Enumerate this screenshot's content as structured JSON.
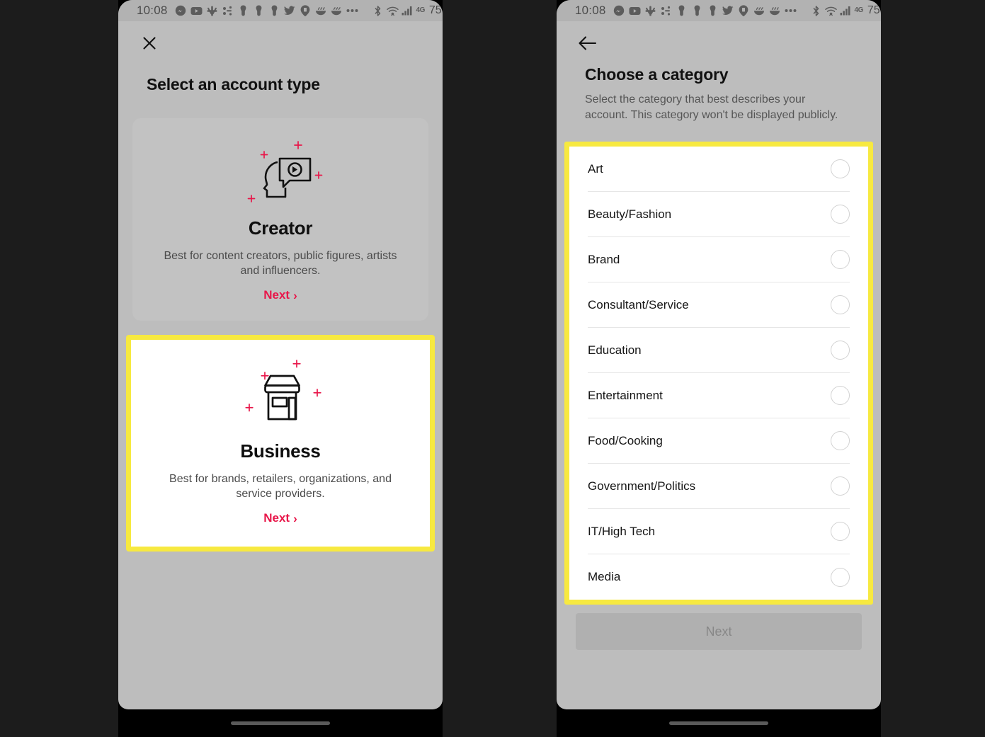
{
  "theme": {
    "screen_bg": "#bdbdbd",
    "statusbar_bg": "#b2b2b2",
    "card_bg": "#c2c2c2",
    "highlight_yellow": "#f7e940",
    "accent_red": "#e8174a",
    "frame_black": "#1c1c1c"
  },
  "status_bar": {
    "time": "10:08",
    "battery_percent": "75%",
    "network_label": "4G",
    "left_icons": [
      "messenger-icon",
      "youtube-icon",
      "slack-icon",
      "dots-connect-icon",
      "pin-hand-icon",
      "pin-hand-icon-2",
      "pin-hand-icon-3",
      "twitter-icon",
      "location-tag-icon",
      "food-bowl-icon",
      "food-bowl-icon-2",
      "more-dots-icon"
    ],
    "right_icons": [
      "bluetooth-icon",
      "wifi-icon",
      "signal-bars-icon",
      "network-4g-icon",
      "battery-icon"
    ]
  },
  "left_screen": {
    "nav": {
      "close_label": "close-icon"
    },
    "title": "Select an account type",
    "cards": [
      {
        "id": "creator",
        "icon": "head-play-bubble-icon",
        "name": "Creator",
        "description": "Best for content creators, public figures, artists and influencers.",
        "next_label": "Next",
        "chevron": "›",
        "highlighted": false
      },
      {
        "id": "business",
        "icon": "storefront-icon",
        "name": "Business",
        "description": "Best for brands, retailers, organizations, and service providers.",
        "next_label": "Next",
        "chevron": "›",
        "highlighted": true
      }
    ]
  },
  "right_screen": {
    "nav": {
      "back_label": "back-arrow-icon"
    },
    "title": "Choose a category",
    "subtitle": "Select the category that best describes your account. This category won't be displayed publicly.",
    "categories": [
      {
        "label": "Art",
        "selected": false
      },
      {
        "label": "Beauty/Fashion",
        "selected": false
      },
      {
        "label": "Brand",
        "selected": false
      },
      {
        "label": "Consultant/Service",
        "selected": false
      },
      {
        "label": "Education",
        "selected": false
      },
      {
        "label": "Entertainment",
        "selected": false
      },
      {
        "label": "Food/Cooking",
        "selected": false
      },
      {
        "label": "Government/Politics",
        "selected": false
      },
      {
        "label": "IT/High Tech",
        "selected": false
      },
      {
        "label": "Media",
        "selected": false
      }
    ],
    "next_button": {
      "label": "Next",
      "enabled": false
    }
  }
}
